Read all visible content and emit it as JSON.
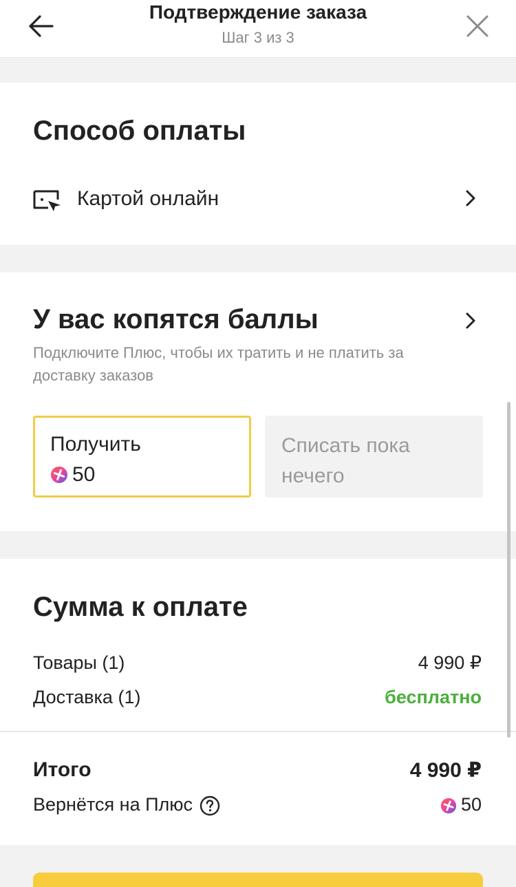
{
  "header": {
    "title": "Подтверждение заказа",
    "subtitle": "Шаг 3 из 3"
  },
  "payment": {
    "title": "Способ оплаты",
    "method": "Картой онлайн"
  },
  "points": {
    "title": "У вас копятся баллы",
    "description": "Подключите Плюс, чтобы их тратить и не платить за доставку заказов",
    "get_label": "Получить",
    "get_value": "50",
    "spend_label": "Списать пока нечего"
  },
  "summary": {
    "title": "Сумма к оплате",
    "items_label": "Товары (1)",
    "items_value": "4 990 ₽",
    "delivery_label": "Доставка (1)",
    "delivery_value": "бесплатно",
    "total_label": "Итого",
    "total_value": "4 990 ₽",
    "return_label": "Вернётся на Плюс",
    "return_value": "50"
  },
  "colors": {
    "accent_yellow": "#f7cd3e",
    "outline_yellow": "#f0cc45",
    "free_green": "#4caf3c"
  }
}
